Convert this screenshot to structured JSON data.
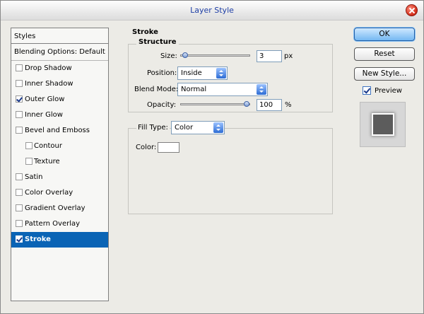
{
  "window": {
    "title": "Layer Style"
  },
  "styles_panel": {
    "header": "Styles",
    "blending_options": "Blending Options: Default",
    "items": [
      {
        "label": "Drop Shadow",
        "checked": false
      },
      {
        "label": "Inner Shadow",
        "checked": false
      },
      {
        "label": "Outer Glow",
        "checked": true
      },
      {
        "label": "Inner Glow",
        "checked": false
      },
      {
        "label": "Bevel and Emboss",
        "checked": false
      },
      {
        "label": "Contour",
        "checked": false
      },
      {
        "label": "Texture",
        "checked": false
      },
      {
        "label": "Satin",
        "checked": false
      },
      {
        "label": "Color Overlay",
        "checked": false
      },
      {
        "label": "Gradient Overlay",
        "checked": false
      },
      {
        "label": "Pattern Overlay",
        "checked": false
      },
      {
        "label": "Stroke",
        "checked": true
      }
    ]
  },
  "stroke": {
    "title": "Stroke",
    "structure_title": "Structure",
    "size_label": "Size:",
    "size_value": "3",
    "size_unit": "px",
    "size_slider_fraction": 0.02,
    "position_label": "Position:",
    "position_value": "Inside",
    "blend_mode_label": "Blend Mode:",
    "blend_mode_value": "Normal",
    "opacity_label": "Opacity:",
    "opacity_value": "100",
    "opacity_unit": "%",
    "opacity_slider_fraction": 1.0,
    "fill_type_label": "Fill Type:",
    "fill_type_value": "Color",
    "color_label": "Color:",
    "color_value": "#ffffff"
  },
  "buttons": {
    "ok": "OK",
    "reset": "Reset",
    "new_style": "New Style...",
    "preview_label": "Preview",
    "preview_checked": true
  },
  "icons": [
    "close-icon",
    "checkbox-icon",
    "dropdown-arrow-icon",
    "slider-thumb-icon"
  ],
  "colors": {
    "selection": "#0a64b5",
    "title_text": "#1f3fa6",
    "close_button": "#d22b17",
    "preview_square": "#5c5c5c"
  }
}
